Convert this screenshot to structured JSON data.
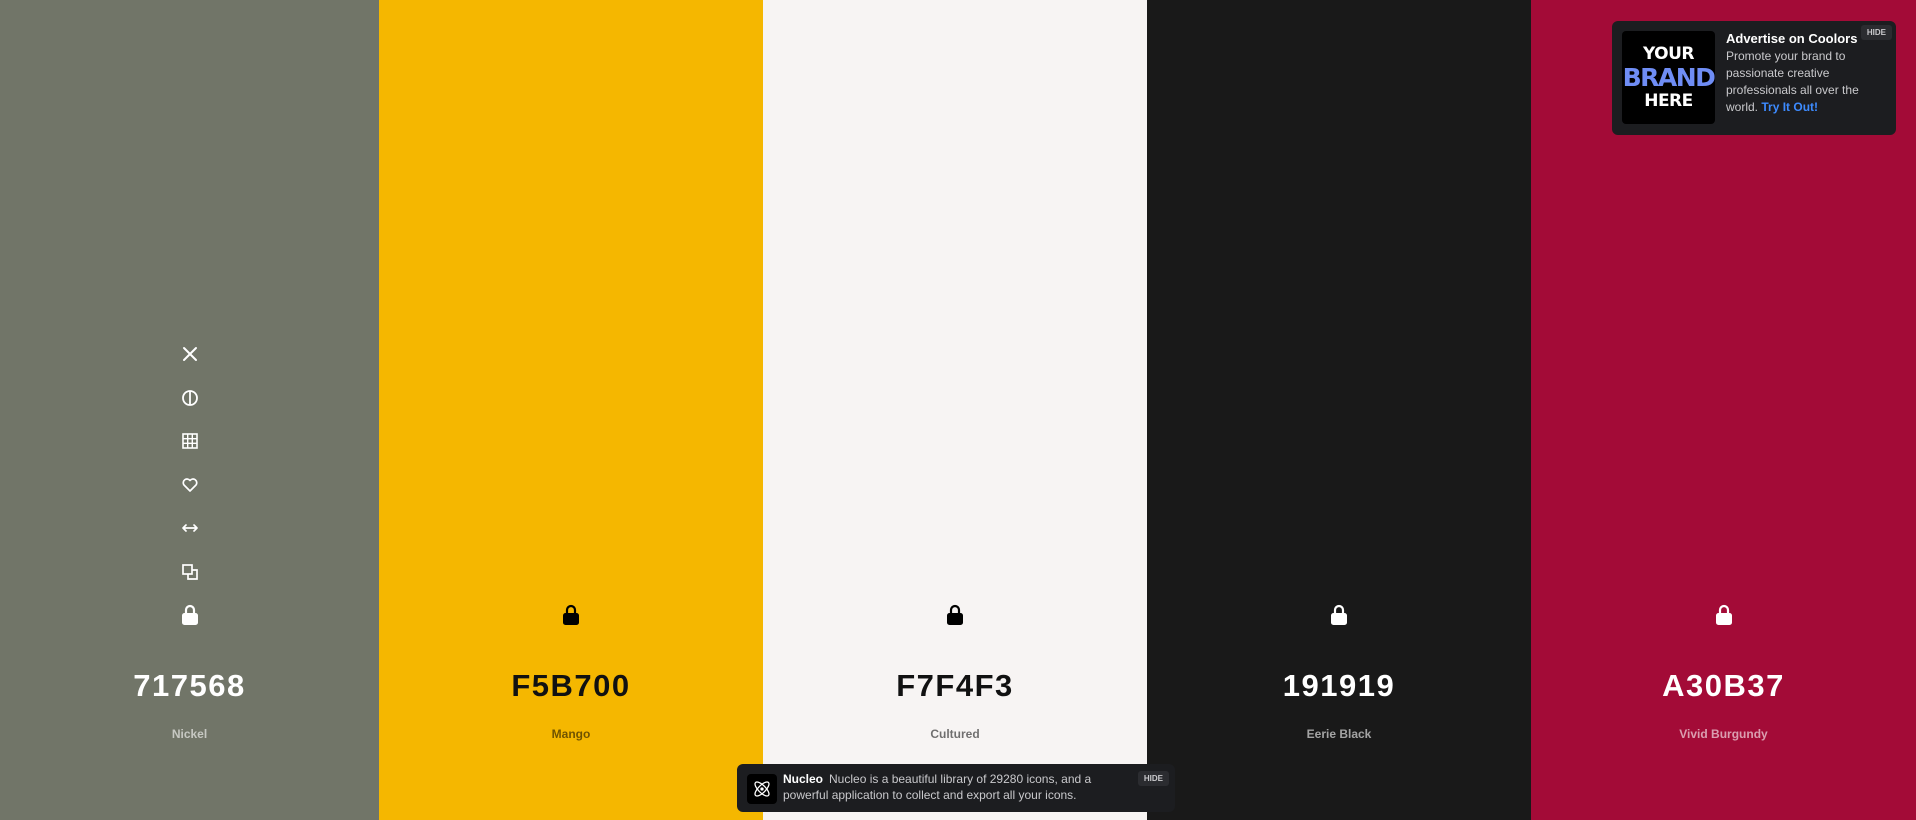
{
  "palette": {
    "colors": [
      {
        "hex": "717568",
        "name": "Nickel",
        "bg": "#717568"
      },
      {
        "hex": "F5B700",
        "name": "Mango",
        "bg": "#F5B700"
      },
      {
        "hex": "F7F4F3",
        "name": "Cultured",
        "bg": "#F7F4F3"
      },
      {
        "hex": "191919",
        "name": "Eerie Black",
        "bg": "#191919"
      },
      {
        "hex": "A30B37",
        "name": "Vivid Burgundy",
        "bg": "#A30B37"
      }
    ],
    "tools": [
      "close-icon",
      "contrast-icon",
      "grid-icon",
      "heart-icon",
      "drag-arrows-icon",
      "copy-icon"
    ],
    "lock_icon": "lock-icon"
  },
  "ad": {
    "logo_line1": "YOUR",
    "logo_line2": "BRAND",
    "logo_line3": "HERE",
    "title": "Advertise on Coolors",
    "body": "Promote your brand to passionate creative professionals all over the world.",
    "cta": "Try It Out!",
    "hide_label": "HIDE"
  },
  "toast": {
    "brand": "Nucleo",
    "message": "Nucleo is a beautiful library of 29280 icons, and a powerful application to collect and export all your icons.",
    "hide_label": "HIDE"
  }
}
